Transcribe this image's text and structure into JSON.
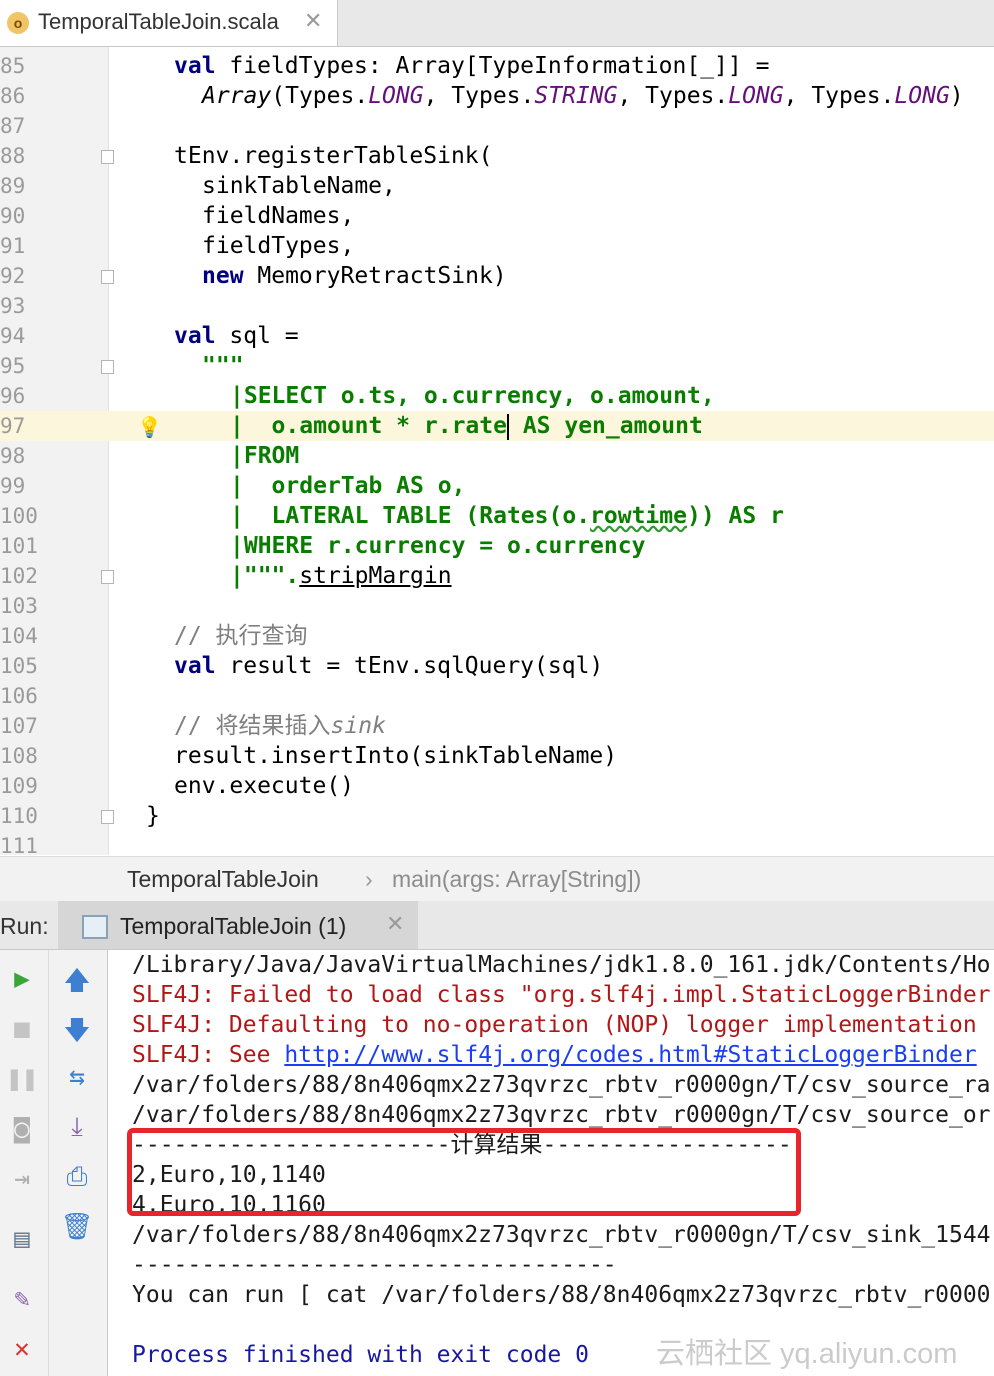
{
  "tab": {
    "icon": "o",
    "title": "TemporalTableJoin.scala",
    "close": "✕"
  },
  "editor": {
    "lines": [
      {
        "n": "85"
      },
      {
        "n": "86"
      },
      {
        "n": "87"
      },
      {
        "n": "88"
      },
      {
        "n": "89"
      },
      {
        "n": "90"
      },
      {
        "n": "91"
      },
      {
        "n": "92"
      },
      {
        "n": "93"
      },
      {
        "n": "94"
      },
      {
        "n": "95"
      },
      {
        "n": "96"
      },
      {
        "n": "97"
      },
      {
        "n": "98"
      },
      {
        "n": "99"
      },
      {
        "n": "100"
      },
      {
        "n": "101"
      },
      {
        "n": "102"
      },
      {
        "n": "103"
      },
      {
        "n": "104"
      },
      {
        "n": "105"
      },
      {
        "n": "106"
      },
      {
        "n": "107"
      },
      {
        "n": "108"
      },
      {
        "n": "109"
      },
      {
        "n": "110"
      },
      {
        "n": "111"
      }
    ],
    "code": {
      "l85_kw": "val",
      "l85_rest": " fieldTypes: Array[TypeInformation[_]] =",
      "l86_arr": "Array",
      "l86_a": "(Types.",
      "l86_t1": "LONG",
      "l86_b": ", Types.",
      "l86_t2": "STRING",
      "l86_c": ", Types.",
      "l86_t3": "LONG",
      "l86_d": ", Types.",
      "l86_t4": "LONG",
      "l86_e": ")",
      "l88": "tEnv.registerTableSink(",
      "l89": "sinkTableName,",
      "l90": "fieldNames,",
      "l91": "fieldTypes,",
      "l92_kw": "new",
      "l92_rest": " MemoryRetractSink)",
      "l94_kw": "val",
      "l94_rest": " sql =",
      "l95": "\"\"\"",
      "l96_bar": "|",
      "l96": "SELECT o.ts, o.currency, o.amount,",
      "l97_bar": "|",
      "l97_a": "  o.amount * r.rate",
      "l97_b": " AS yen_amount",
      "l98_bar": "|",
      "l98": "FROM",
      "l99_bar": "|",
      "l99": "  orderTab AS o,",
      "l100_bar": "|",
      "l100_a": "  LATERAL TABLE (Rates(o.",
      "l100_b": "rowtime",
      "l100_c": ")) AS r",
      "l101_bar": "|",
      "l101": "WHERE r.currency = o.currency",
      "l102_bar": "|",
      "l102_a": "\"\"\".",
      "l102_b": "stripMargin",
      "l104": "// 执行查询",
      "l105_kw": "val",
      "l105_rest": " result = tEnv.sqlQuery(sql)",
      "l107_a": "// 将结果插入",
      "l107_b": "sink",
      "l108": "result.insertInto(sinkTableName)",
      "l109": "env.execute()",
      "l110": "}"
    }
  },
  "breadcrumb": {
    "class_name": "TemporalTableJoin",
    "separator": "›",
    "method": "main(args: Array[String])"
  },
  "run": {
    "label": "Run:",
    "tab_title": "TemporalTableJoin (1)",
    "tab_close": "✕",
    "console": {
      "l1": "/Library/Java/JavaVirtualMachines/jdk1.8.0_161.jdk/Contents/Ho",
      "l2": "SLF4J: Failed to load class \"org.slf4j.impl.StaticLoggerBinder",
      "l3": "SLF4J: Defaulting to no-operation (NOP) logger implementation",
      "l4_a": "SLF4J: See ",
      "l4_link": "http://www.slf4j.org/codes.html#StaticLoggerBinder",
      "l5": "/var/folders/88/8n406qmx2z73qvrzc_rbtv_r0000gn/T/csv_source_ra",
      "l6": "/var/folders/88/8n406qmx2z73qvrzc_rbtv_r0000gn/T/csv_source_or",
      "l7": "-----------------------计算结果------------------",
      "l8": "2,Euro,10,1140",
      "l9": "4,Euro,10,1160",
      "l10": "/var/folders/88/8n406qmx2z73qvrzc_rbtv_r0000gn/T/csv_sink_1544",
      "l11": "-----------------------------------",
      "l12": "You can run [ cat /var/folders/88/8n406qmx2z73qvrzc_rbtv_r0000",
      "l13": "Process finished with exit code 0"
    }
  },
  "watermark": "云栖社区 yq.aliyun.com",
  "colors": {
    "keyword": "#000080",
    "sql": "#0a7d00",
    "error": "#b01818",
    "highlight_box": "#e8242c"
  }
}
